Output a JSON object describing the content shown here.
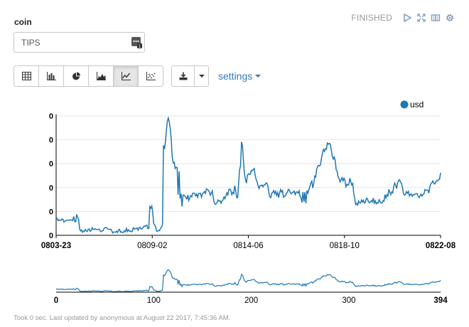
{
  "paragraph": {
    "title": "coin",
    "status": "FINISHED",
    "input_value": "TIPS"
  },
  "toolbar": {
    "buttons": [
      "table",
      "bar-chart",
      "pie-chart",
      "area-chart",
      "line-chart",
      "scatter-chart"
    ],
    "active": "line-chart",
    "settings_label": "settings"
  },
  "colors": {
    "accent": "#337ab7",
    "line": "#1f77b4",
    "status_icon": "#7a98b8"
  },
  "chart_data": [
    {
      "type": "line",
      "legend": {
        "series": [
          "usd"
        ],
        "position": "top-right"
      },
      "series": [
        {
          "name": "usd",
          "values": [
            0.124,
            0.127,
            0.118,
            0.121,
            0.118,
            0.12,
            0.124,
            0.123,
            0.112,
            0.116,
            0.117,
            0.12,
            0.12,
            0.12,
            0.12,
            0.121,
            0.12,
            0.118,
            0.134,
            0.114,
            0.113,
            0.142,
            0.132,
            0.123,
            0.086,
            0.077,
            0.081,
            0.072,
            0.077,
            0.075,
            0.083,
            0.077,
            0.075,
            0.084,
            0.085,
            0.075,
            0.079,
            0.09,
            0.083,
            0.083,
            0.086,
            0.083,
            0.083,
            0.083,
            0.084,
            0.078,
            0.074,
            0.077,
            0.078,
            0.086,
            0.09,
            0.091,
            0.089,
            0.085,
            0.083,
            0.083,
            0.084,
            0.078,
            0.069,
            0.073,
            0.073,
            0.072,
            0.076,
            0.071,
            0.082,
            0.083,
            0.072,
            0.074,
            0.071,
            0.071,
            0.078,
            0.074,
            0.087,
            0.075,
            0.082,
            0.076,
            0.077,
            0.074,
            0.075,
            0.089,
            0.084,
            0.087,
            0.086,
            0.089,
            0.08,
            0.089,
            0.092,
            0.085,
            0.085,
            0.09,
            0.096,
            0.095,
            0.098,
            0.1,
            0.086,
            0.088,
            0.173,
            0.167,
            0.175,
            0.15,
            0.106,
            0.1,
            0.093,
            0.076,
            0.077,
            0.079,
            0.078,
            0.088,
            0.092,
            0.102,
            0.414,
            0.4,
            0.428,
            0.474,
            0.51,
            0.522,
            0.504,
            0.477,
            0.436,
            0.366,
            0.345,
            0.347,
            0.323,
            0.328,
            0.326,
            0.22,
            0.312,
            0.205,
            0.223,
            0.173,
            0.218,
            0.218,
            0.214,
            0.209,
            0.203,
            0.219,
            0.197,
            0.208,
            0.216,
            0.212,
            0.226,
            0.226,
            0.225,
            0.215,
            0.222,
            0.21,
            0.224,
            0.225,
            0.225,
            0.21,
            0.224,
            0.227,
            0.232,
            0.225,
            0.243,
            0.24,
            0.237,
            0.23,
            0.218,
            0.225,
            0.235,
            0.209,
            0.189,
            0.182,
            0.184,
            0.19,
            0.199,
            0.194,
            0.196,
            0.186,
            0.195,
            0.199,
            0.211,
            0.204,
            0.215,
            0.227,
            0.219,
            0.24,
            0.242,
            0.237,
            0.22,
            0.229,
            0.224,
            0.255,
            0.237,
            0.209,
            0.208,
            0.264,
            0.317,
            0.333,
            0.428,
            0.41,
            0.353,
            0.302,
            0.28,
            0.265,
            0.295,
            0.302,
            0.3,
            0.3,
            0.315,
            0.314,
            0.319,
            0.323,
            0.296,
            0.279,
            0.27,
            0.255,
            0.244,
            0.255,
            0.255,
            0.258,
            0.251,
            0.258,
            0.258,
            0.266,
            0.265,
            0.253,
            0.228,
            0.211,
            0.208,
            0.226,
            0.229,
            0.236,
            0.224,
            0.233,
            0.217,
            0.228,
            0.208,
            0.226,
            0.24,
            0.23,
            0.236,
            0.21,
            0.214,
            0.215,
            0.226,
            0.229,
            0.241,
            0.237,
            0.228,
            0.223,
            0.228,
            0.23,
            0.234,
            0.22,
            0.23,
            0.231,
            0.226,
            0.235,
            0.213,
            0.208,
            0.189,
            0.23,
            0.193,
            0.23,
            0.186,
            0.236,
            0.226,
            0.24,
            0.252,
            0.266,
            0.273,
            0.246,
            0.264,
            0.293,
            0.289,
            0.32,
            0.331,
            0.335,
            0.333,
            0.338,
            0.365,
            0.384,
            0.398,
            0.39,
            0.401,
            0.398,
            0.423,
            0.418,
            0.422,
            0.418,
            0.396,
            0.371,
            0.36,
            0.368,
            0.356,
            0.317,
            0.311,
            0.29,
            0.283,
            0.27,
            0.278,
            0.287,
            0.274,
            0.285,
            0.277,
            0.251,
            0.261,
            0.257,
            0.26,
            0.285,
            0.27,
            0.258,
            0.264,
            0.226,
            0.204,
            0.181,
            0.186,
            0.179,
            0.195,
            0.188,
            0.187,
            0.199,
            0.191,
            0.198,
            0.187,
            0.191,
            0.206,
            0.204,
            0.193,
            0.188,
            0.191,
            0.196,
            0.191,
            0.207,
            0.187,
            0.196,
            0.184,
            0.189,
            0.187,
            0.2,
            0.192,
            0.187,
            0.187,
            0.196,
            0.194,
            0.22,
            0.207,
            0.22,
            0.215,
            0.241,
            0.228,
            0.22,
            0.231,
            0.227,
            0.253,
            0.266,
            0.256,
            0.244,
            0.267,
            0.276,
            0.279,
            0.269,
            0.263,
            0.248,
            0.224,
            0.218,
            0.22,
            0.232,
            0.226,
            0.233,
            0.215,
            0.221,
            0.223,
            0.214,
            0.22,
            0.219,
            0.223,
            0.224,
            0.224,
            0.213,
            0.208,
            0.216,
            0.222,
            0.214,
            0.221,
            0.223,
            0.24,
            0.237,
            0.238,
            0.238,
            0.226,
            0.251,
            0.263,
            0.266,
            0.274,
            0.265,
            0.262,
            0.269,
            0.275,
            0.274,
            0.28,
            0.281,
            0.306
          ]
        }
      ],
      "x_tick_labels": [
        "0803-23",
        "0809-02",
        "0814-06",
        "0818-10",
        "0822-08"
      ],
      "y_tick_labels": [
        "0",
        "0",
        "0",
        "0",
        "0",
        "0"
      ],
      "grid": true
    },
    {
      "type": "line",
      "role": "range-selector",
      "x_tick_labels": [
        "0",
        "100",
        "200",
        "300",
        "394"
      ],
      "xlim": [
        0,
        394
      ]
    }
  ],
  "footer": {
    "text": "Took 0 sec. Last updated by anonymous at August 22 2017, 7:45:36 AM."
  }
}
